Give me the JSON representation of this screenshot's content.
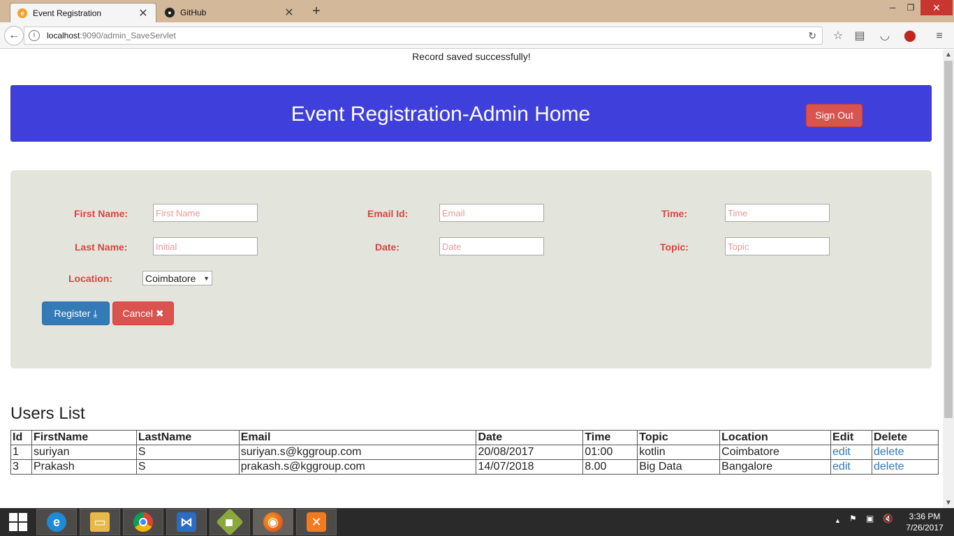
{
  "browser": {
    "tabs": [
      {
        "label": "Event Registration",
        "active": true
      },
      {
        "label": "GitHub",
        "active": false
      }
    ],
    "url_host": "localhost",
    "url_path": ":9090/admin_SaveServlet"
  },
  "page": {
    "status_message": "Record saved successfully!",
    "header_title": "Event Registration-Admin Home",
    "signout_label": "Sign Out",
    "form": {
      "first_name_label": "First Name:",
      "first_name_placeholder": "First Name",
      "last_name_label": "Last Name:",
      "last_name_placeholder": "Initial",
      "email_label": "Email Id:",
      "email_placeholder": "Email",
      "date_label": "Date:",
      "date_placeholder": "Date",
      "time_label": "Time:",
      "time_placeholder": "Time",
      "topic_label": "Topic:",
      "topic_placeholder": "Topic",
      "location_label": "Location:",
      "location_value": "Coimbatore",
      "register_label": "Register",
      "cancel_label": "Cancel"
    },
    "users_title": "Users List",
    "table": {
      "headers": [
        "Id",
        "FirstName",
        "LastName",
        "Email",
        "Date",
        "Time",
        "Topic",
        "Location",
        "Edit",
        "Delete"
      ],
      "rows": [
        {
          "id": "1",
          "first": "suriyan",
          "last": "S",
          "email": "suriyan.s@kggroup.com",
          "date": "20/08/2017",
          "time": "01:00",
          "topic": "kotlin",
          "location": "Coimbatore",
          "edit": "edit",
          "delete": "delete"
        },
        {
          "id": "3",
          "first": "Prakash",
          "last": "S",
          "email": "prakash.s@kggroup.com",
          "date": "14/07/2018",
          "time": "8.00",
          "topic": "Big Data",
          "location": "Bangalore",
          "edit": "edit",
          "delete": "delete"
        }
      ]
    }
  },
  "taskbar": {
    "time": "3:36 PM",
    "date": "7/26/2017"
  },
  "colors": {
    "header_bg": "#3f3fdb",
    "form_bg": "#e3e5dc",
    "label_red": "#d9443f",
    "primary_blue": "#337ab7",
    "danger_red": "#d9534f"
  }
}
